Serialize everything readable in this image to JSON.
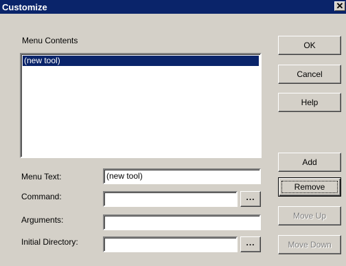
{
  "window": {
    "title": "Customize",
    "close_glyph": "✕"
  },
  "menu_contents": {
    "label": "Menu Contents",
    "items": [
      "(new tool)"
    ]
  },
  "fields": {
    "menu_text": {
      "label": "Menu Text:",
      "value": "(new tool)"
    },
    "command": {
      "label": "Command:",
      "value": ""
    },
    "arguments": {
      "label": "Arguments:",
      "value": ""
    },
    "initial_directory": {
      "label": "Initial Directory:",
      "value": ""
    },
    "browse_label": "..."
  },
  "buttons": {
    "ok": "OK",
    "cancel": "Cancel",
    "help": "Help",
    "add": "Add",
    "remove": "Remove",
    "move_up": "Move Up",
    "move_down": "Move Down"
  },
  "colors": {
    "title_bar": "#0a246a",
    "dialog_face": "#d4d0c8",
    "selection": "#0a246a",
    "disabled_text": "#808080"
  }
}
